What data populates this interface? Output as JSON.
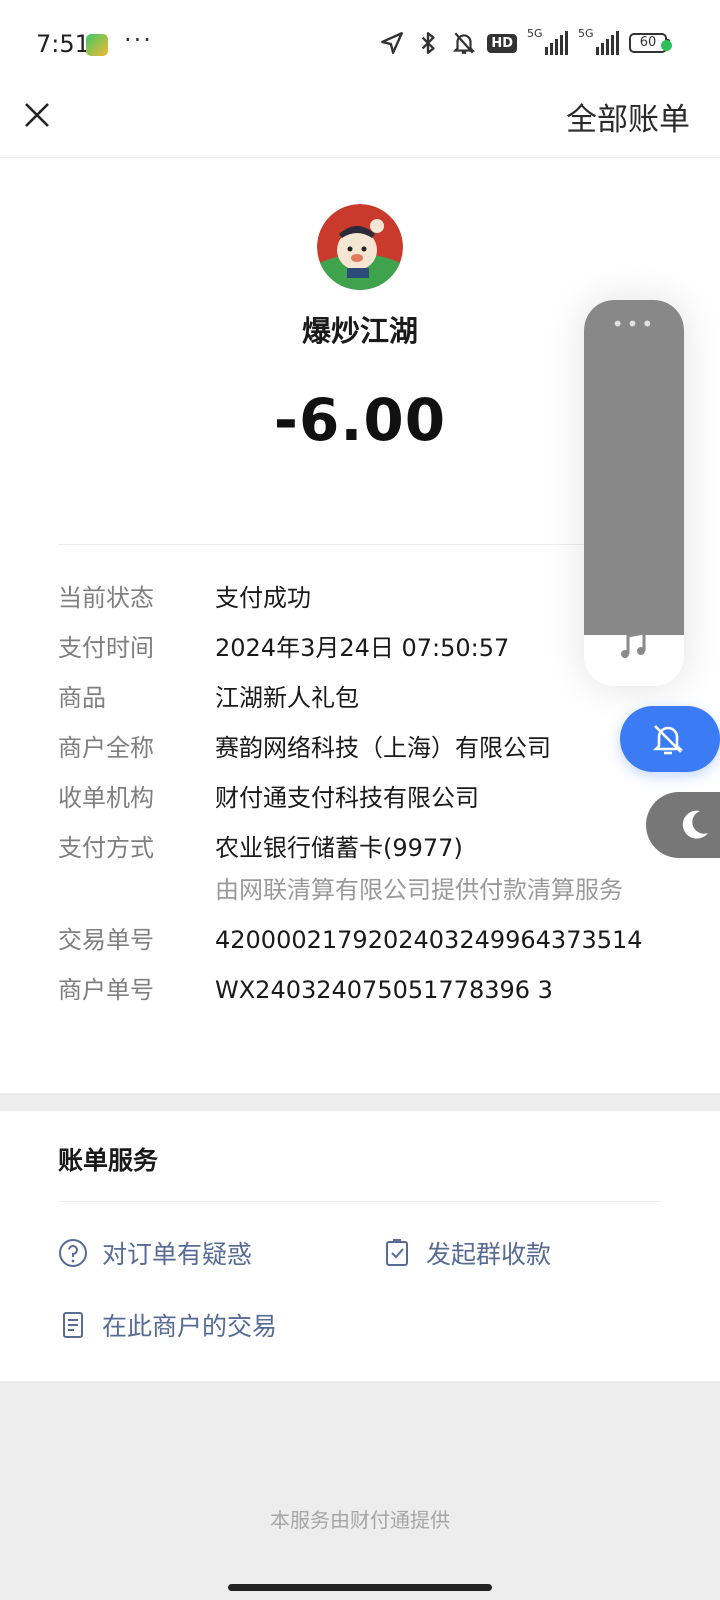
{
  "status_bar": {
    "time": "7:51",
    "more": "···",
    "icons": [
      "location-icon",
      "bluetooth-icon",
      "mute-icon",
      "hd-icon",
      "signal-5g-icon",
      "signal-5g-icon",
      "battery-icon"
    ],
    "hd_label": "HD",
    "network_label_1": "5G",
    "network_label_2": "5G",
    "battery": "60"
  },
  "header": {
    "close_icon": "close-icon",
    "right_action": "全部账单"
  },
  "transaction": {
    "merchant_name": "爆炒江湖",
    "amount": "-6.00",
    "details": [
      {
        "label": "当前状态",
        "value": "支付成功"
      },
      {
        "label": "支付时间",
        "value": "2024年3月24日 07:50:57"
      },
      {
        "label": "商品",
        "value": "江湖新人礼包"
      },
      {
        "label": "商户全称",
        "value": "赛韵网络科技（上海）有限公司"
      },
      {
        "label": "收单机构",
        "value": "财付通支付科技有限公司"
      },
      {
        "label": "支付方式",
        "value": "农业银行储蓄卡(9977)",
        "sub": "由网联清算有限公司提供付款清算服务"
      },
      {
        "label": "交易单号",
        "value": "4200002179202403249964373514"
      },
      {
        "label": "商户单号",
        "value": "WX240324075051778396 3"
      }
    ]
  },
  "services": {
    "title": "账单服务",
    "items": [
      {
        "label": "对订单有疑惑",
        "icon": "question-circle-icon"
      },
      {
        "label": "发起群收款",
        "icon": "group-collect-icon"
      },
      {
        "label": "在此商户的交易",
        "icon": "document-list-icon"
      }
    ]
  },
  "footer": {
    "provided_by": "本服务由财付通提供"
  },
  "overlay": {
    "more": "•••",
    "icons": [
      "music-note-icon",
      "bell-off-icon",
      "moon-icon"
    ],
    "accent_color": "#3b7cf4"
  }
}
